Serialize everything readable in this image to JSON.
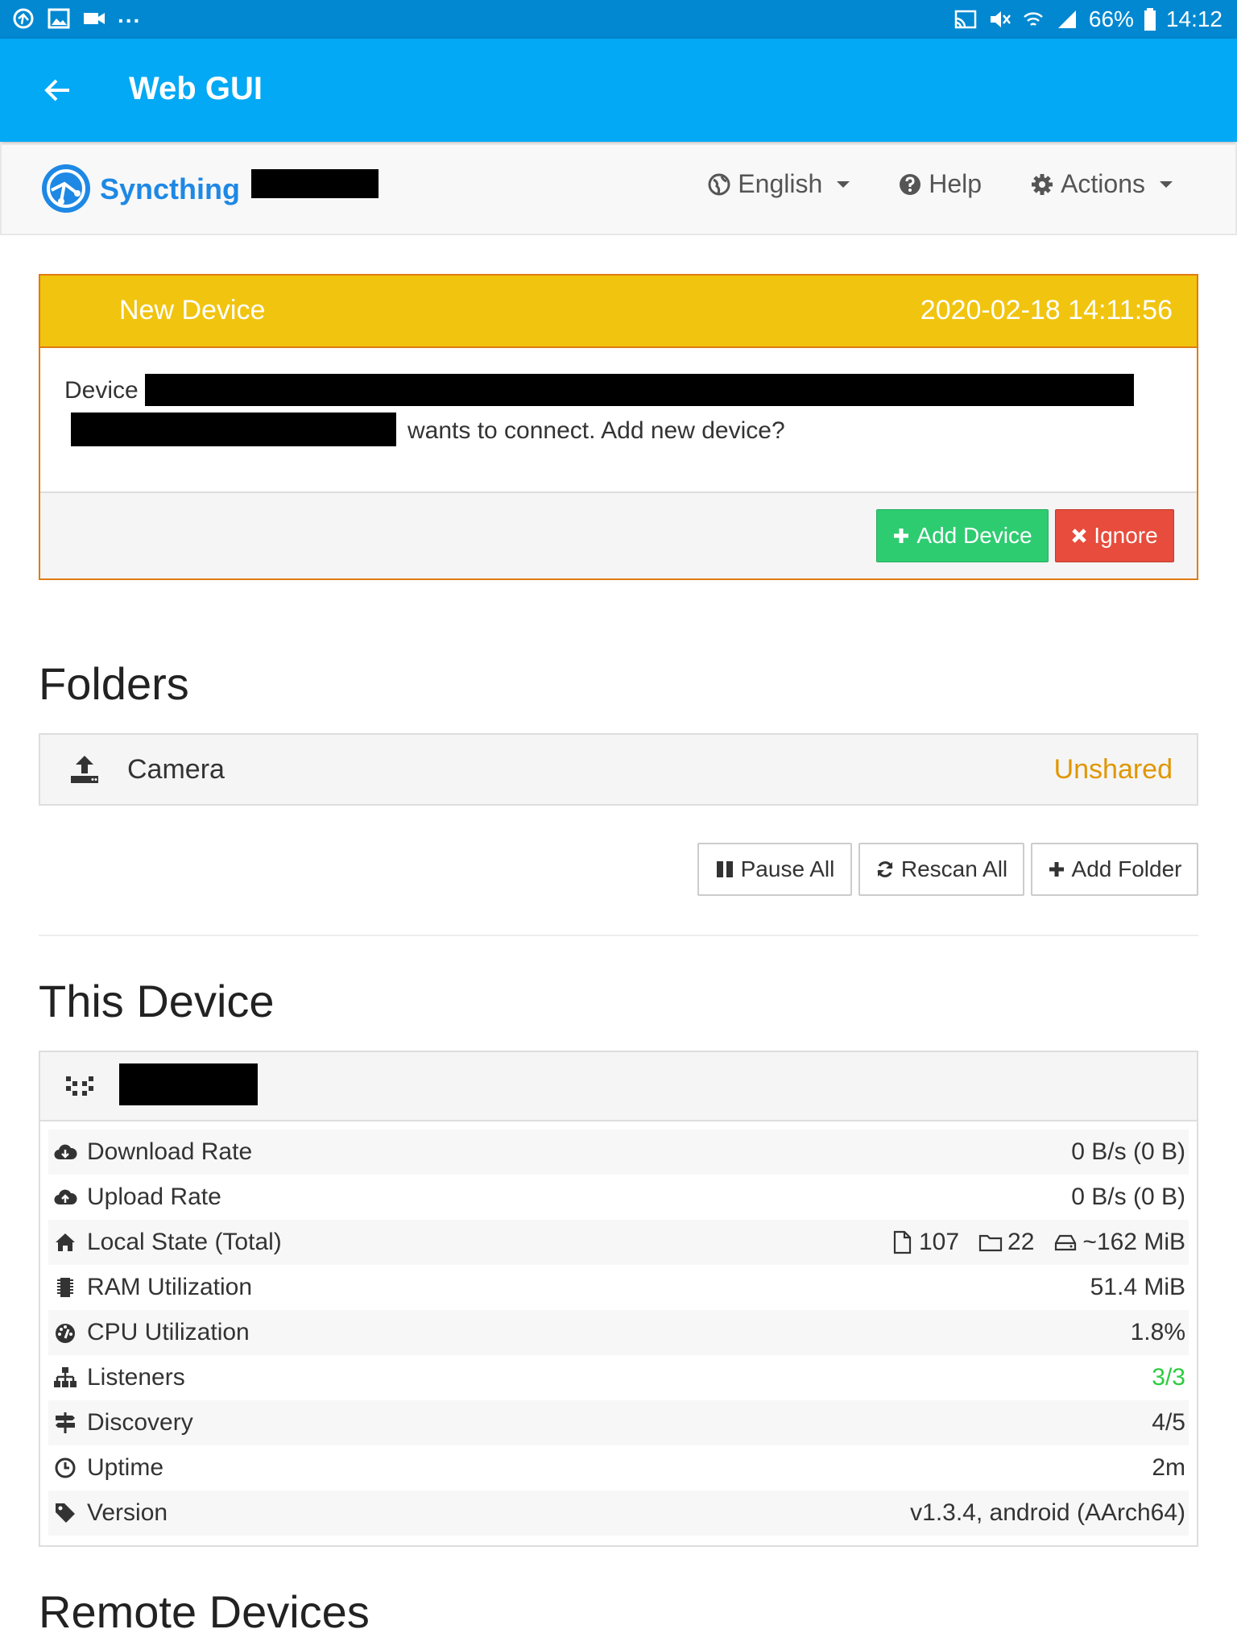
{
  "status_bar": {
    "dots": "...",
    "battery": "66%",
    "time": "14:12"
  },
  "app_bar": {
    "title": "Web GUI"
  },
  "navbar": {
    "brand": "Syncthing",
    "language": "English",
    "help": "Help",
    "actions": "Actions"
  },
  "notification": {
    "title": "New Device",
    "date": "2020-02-18 14:11:56",
    "line1": "Device",
    "line2": "wants to connect. Add new device?",
    "add_label": "Add Device",
    "ignore_label": "Ignore"
  },
  "folders": {
    "heading": "Folders",
    "items": [
      {
        "name": "Camera",
        "state": "Unshared"
      }
    ],
    "pause_all": "Pause All",
    "rescan_all": "Rescan All",
    "add_folder": "Add Folder"
  },
  "this_device": {
    "heading": "This Device",
    "rows": [
      {
        "label": "Download Rate",
        "value": "0 B/s (0 B)"
      },
      {
        "label": "Upload Rate",
        "value": "0 B/s (0 B)"
      },
      {
        "label": "Local State (Total)",
        "files": "107",
        "dirs": "22",
        "size": "~162 MiB"
      },
      {
        "label": "RAM Utilization",
        "value": "51.4 MiB"
      },
      {
        "label": "CPU Utilization",
        "value": "1.8%"
      },
      {
        "label": "Listeners",
        "value": "3/3"
      },
      {
        "label": "Discovery",
        "value": "4/5"
      },
      {
        "label": "Uptime",
        "value": "2m"
      },
      {
        "label": "Version",
        "value": "v1.3.4, android (AArch64)"
      }
    ]
  },
  "remote_devices": {
    "heading": "Remote Devices"
  },
  "colors": {
    "status_bar": "#0288d1",
    "app_bar": "#03a9f4",
    "notification_header": "#f1c40f",
    "add_button": "#2ecc71",
    "ignore_button": "#e74c3c",
    "unshared": "#e09600",
    "listeners_ok": "#2ecc40"
  }
}
